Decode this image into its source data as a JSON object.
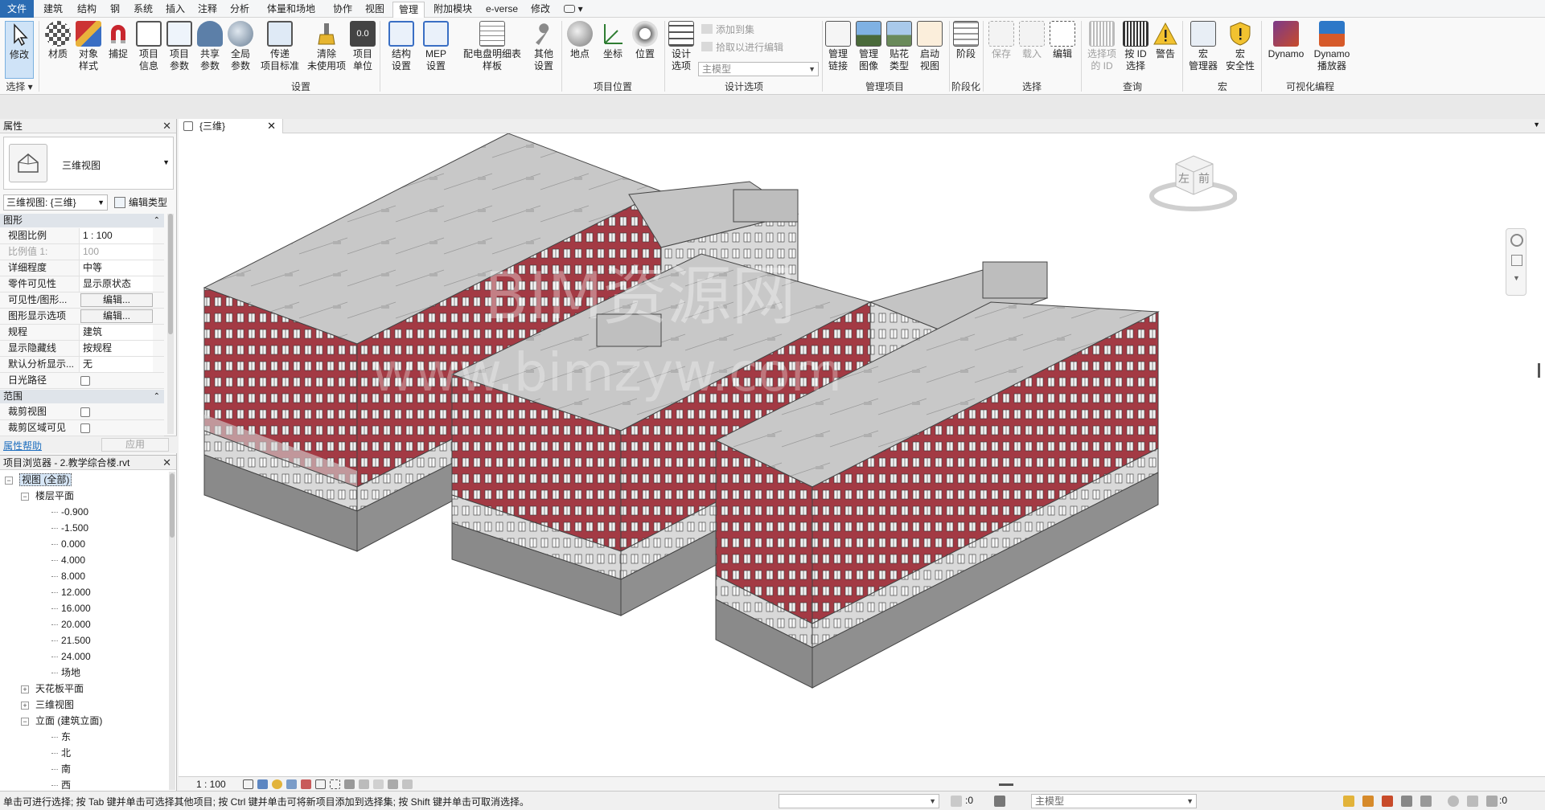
{
  "menu": {
    "tabs": [
      "文件",
      "建筑",
      "结构",
      "钢",
      "系统",
      "插入",
      "注释",
      "分析",
      "体量和场地",
      "协作",
      "视图",
      "管理",
      "附加模块",
      "e-verse",
      "修改"
    ],
    "active_tab": "管理"
  },
  "ribbon": {
    "buttons": [
      "修改",
      "材质",
      "对象\n样式",
      "捕捉",
      "项目\n信息",
      "项目\n参数",
      "共享\n参数",
      "全局\n参数",
      "传递\n项目标准",
      "清除\n未使用项",
      "项目\n单位",
      "结构\n设置",
      "MEP\n设置",
      "配电盘明细表\n样板",
      "其他\n设置",
      "地点",
      "坐标",
      "位置",
      "设计\n选项",
      "管理\n链接",
      "管理\n图像",
      "贴花\n类型",
      "启动\n视图",
      "阶段",
      "保存",
      "载入",
      "编辑",
      "选择项\n的 ID",
      "按 ID\n选择",
      "警告",
      "宏\n管理器",
      "宏\n安全性",
      "Dynamo",
      "Dynamo\n播放器"
    ],
    "small_buttons": [
      "添加到集",
      "拾取以进行编辑"
    ],
    "design_option_combo": "主模型",
    "panels": [
      "选择",
      "设置",
      "项目位置",
      "设计选项",
      "管理项目",
      "阶段化",
      "选择",
      "查询",
      "宏",
      "可视化编程"
    ]
  },
  "properties": {
    "title": "属性",
    "type_name": "三维视图",
    "view_select": "三维视图: {三维}",
    "edit_type": "编辑类型",
    "group_graphics": "图形",
    "rows": [
      {
        "k": "视图比例",
        "v": "1 : 100"
      },
      {
        "k": "比例值 1:",
        "v": "100"
      },
      {
        "k": "详细程度",
        "v": "中等"
      },
      {
        "k": "零件可见性",
        "v": "显示原状态"
      },
      {
        "k": "可见性/图形...",
        "v": "编辑..."
      },
      {
        "k": "图形显示选项",
        "v": "编辑..."
      },
      {
        "k": "规程",
        "v": "建筑"
      },
      {
        "k": "显示隐藏线",
        "v": "按规程"
      },
      {
        "k": "默认分析显示...",
        "v": "无"
      },
      {
        "k": "日光路径",
        "v": ""
      }
    ],
    "group_extents": "范围",
    "extent_rows": [
      {
        "k": "裁剪视图",
        "v": ""
      },
      {
        "k": "裁剪区域可见",
        "v": ""
      }
    ],
    "help_link": "属性帮助",
    "apply": "应用"
  },
  "browser": {
    "title": "项目浏览器 - 2.教学综合楼.rvt",
    "items": [
      {
        "label": "视图 (全部)",
        "level": 0,
        "toggle": "−",
        "selected": true
      },
      {
        "label": "楼层平面",
        "level": 1,
        "toggle": "−"
      },
      {
        "label": "-0.900",
        "level": 2
      },
      {
        "label": "-1.500",
        "level": 2
      },
      {
        "label": "0.000",
        "level": 2
      },
      {
        "label": "4.000",
        "level": 2
      },
      {
        "label": "8.000",
        "level": 2
      },
      {
        "label": "12.000",
        "level": 2
      },
      {
        "label": "16.000",
        "level": 2
      },
      {
        "label": "20.000",
        "level": 2
      },
      {
        "label": "21.500",
        "level": 2
      },
      {
        "label": "24.000",
        "level": 2
      },
      {
        "label": "场地",
        "level": 2
      },
      {
        "label": "天花板平面",
        "level": 1,
        "toggle": "+"
      },
      {
        "label": "三维视图",
        "level": 1,
        "toggle": "+"
      },
      {
        "label": "立面 (建筑立面)",
        "level": 1,
        "toggle": "−"
      },
      {
        "label": "东",
        "level": 2
      },
      {
        "label": "北",
        "level": 2
      },
      {
        "label": "南",
        "level": 2
      },
      {
        "label": "西",
        "level": 2
      }
    ]
  },
  "view": {
    "tab_title": "{三维}",
    "scale": "1 : 100",
    "viewcube_left": "左",
    "viewcube_front": "前",
    "watermark": "BIM资源网",
    "watermark_url": "www.bimzyw.com"
  },
  "status": {
    "message": "单击可进行选择; 按 Tab 键并单击可选择其他项目; 按 Ctrl 键并单击可将新项目添加到选择集; 按 Shift 键并单击可取消选择。",
    "count": ":0",
    "model_combo": "主模型",
    "filter_count": ":0"
  },
  "colors": {
    "accent": "#2b6cb3",
    "facade_red": "#a33a44",
    "roof": "#c9c9c9",
    "wall_gray": "#8a8a8a"
  }
}
